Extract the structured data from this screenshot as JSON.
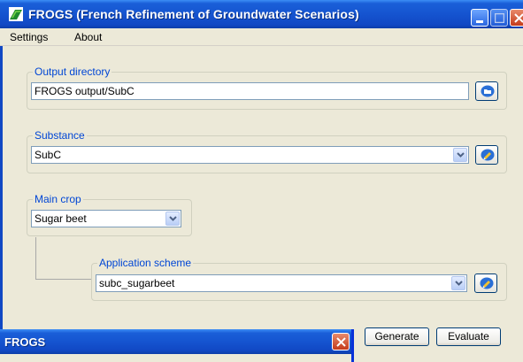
{
  "window": {
    "title": "FROGS (French Refinement of Groundwater Scenarios)",
    "icon": "frog-logo-icon"
  },
  "menu": {
    "items": [
      {
        "label": "Settings"
      },
      {
        "label": "About"
      }
    ]
  },
  "output_directory": {
    "label": "Output directory",
    "value": "FROGS output/SubC",
    "button_icon": "folder-open-icon"
  },
  "substance": {
    "label": "Substance",
    "value": "SubC",
    "button_icon": "edit-icon"
  },
  "main_crop": {
    "label": "Main crop",
    "value": "Sugar beet"
  },
  "application_scheme": {
    "label": "Application scheme",
    "value": "subc_sugarbeet",
    "button_icon": "edit-icon"
  },
  "actions": {
    "generate_label": "Generate",
    "evaluate_label": "Evaluate"
  },
  "child_window": {
    "title": "FROGS"
  },
  "colors": {
    "titlebar": "#1554d0",
    "group_label": "#0046d5",
    "close_button": "#c43b1b",
    "window_bg": "#ece9d8"
  }
}
